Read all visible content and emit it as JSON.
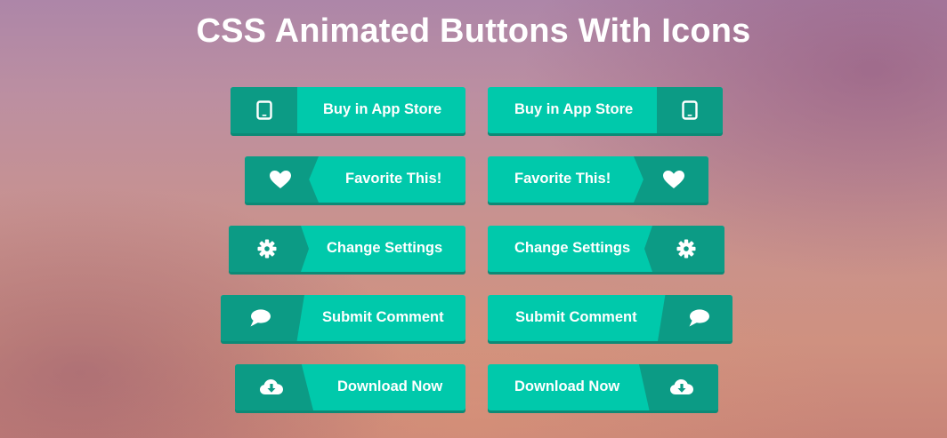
{
  "page": {
    "title": "CSS Animated Buttons With Icons"
  },
  "colors": {
    "button_face": "#00c9ab",
    "icon_panel": "#0c9b85",
    "button_shadow": "#0c8a76",
    "text": "#ffffff"
  },
  "buttons": {
    "app_store_left": {
      "label": "Buy in App Store",
      "icon": "tablet-icon"
    },
    "app_store_right": {
      "label": "Buy in App Store",
      "icon": "tablet-icon"
    },
    "favorite_left": {
      "label": "Favorite This!",
      "icon": "heart-icon"
    },
    "favorite_right": {
      "label": "Favorite This!",
      "icon": "heart-icon"
    },
    "settings_left": {
      "label": "Change Settings",
      "icon": "gear-icon"
    },
    "settings_right": {
      "label": "Change Settings",
      "icon": "gear-icon"
    },
    "comment_left": {
      "label": "Submit Comment",
      "icon": "comment-icon"
    },
    "comment_right": {
      "label": "Submit Comment",
      "icon": "comment-icon"
    },
    "download_left": {
      "label": "Download Now",
      "icon": "cloud-download-icon"
    },
    "download_right": {
      "label": "Download Now",
      "icon": "cloud-download-icon"
    }
  }
}
